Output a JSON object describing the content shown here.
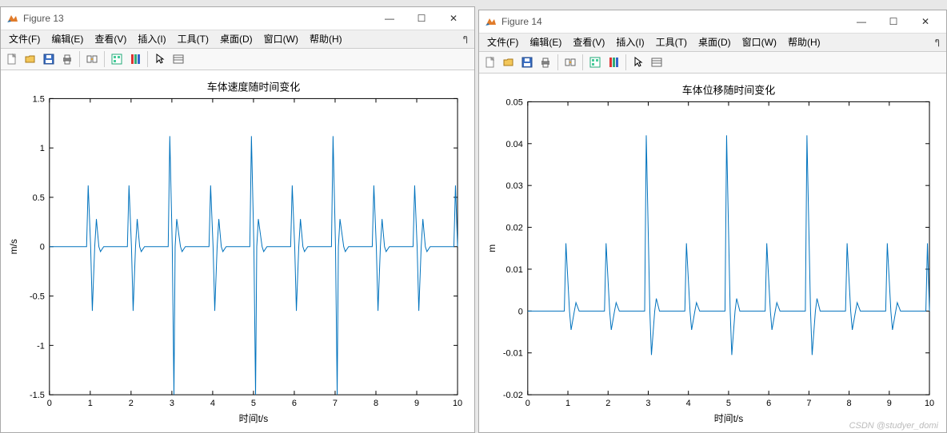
{
  "watermark": "CSDN @studyer_domi",
  "figures": [
    {
      "id": "fig13",
      "window_title": "Figure 13",
      "menus": [
        "文件(F)",
        "编辑(E)",
        "查看(V)",
        "插入(I)",
        "工具(T)",
        "桌面(D)",
        "窗口(W)",
        "帮助(H)"
      ],
      "title": "车体速度随时间变化",
      "xlabel": "时间t/s",
      "ylabel": "m/s",
      "xlim": [
        0,
        10
      ],
      "ylim": [
        -1.5,
        1.5
      ],
      "xticks": [
        0,
        1,
        2,
        3,
        4,
        5,
        6,
        7,
        8,
        9,
        10
      ],
      "yticks": [
        -1.5,
        -1,
        -0.5,
        0,
        0.5,
        1,
        1.5
      ]
    },
    {
      "id": "fig14",
      "window_title": "Figure 14",
      "menus": [
        "文件(F)",
        "编辑(E)",
        "查看(V)",
        "插入(I)",
        "工具(T)",
        "桌面(D)",
        "窗口(W)",
        "帮助(H)"
      ],
      "title": "车体位移随时间变化",
      "xlabel": "时间t/s",
      "ylabel": "m",
      "xlim": [
        0,
        10
      ],
      "ylim": [
        -0.02,
        0.05
      ],
      "xticks": [
        0,
        1,
        2,
        3,
        4,
        5,
        6,
        7,
        8,
        9,
        10
      ],
      "yticks": [
        -0.02,
        -0.01,
        0,
        0.01,
        0.02,
        0.03,
        0.04,
        0.05
      ]
    }
  ],
  "toolbar_icons": [
    "new-icon",
    "open-icon",
    "save-icon",
    "print-icon",
    "sep",
    "link-icon",
    "sep",
    "datacursor-icon",
    "colorbar-icon",
    "sep",
    "pointer-icon",
    "props-icon"
  ],
  "chart_data": [
    {
      "type": "line",
      "figure": "fig13",
      "title": "车体速度随时间变化",
      "xlabel": "时间t/s",
      "ylabel": "m/s",
      "xlim": [
        0,
        10
      ],
      "ylim": [
        -1.5,
        1.5
      ],
      "series": [
        {
          "name": "velocity",
          "color": "#0072bd",
          "pattern": "periodic_pulses",
          "period": 1.0,
          "baseline": 0.0,
          "peaks": [
            {
              "t": 0.95,
              "y": 0.62
            },
            {
              "t": 1.05,
              "y": -0.65
            },
            {
              "t": 1.15,
              "y": 0.28
            },
            {
              "t": 1.25,
              "y": -0.05
            },
            {
              "t": 1.95,
              "y": 0.62
            },
            {
              "t": 2.05,
              "y": -0.65
            },
            {
              "t": 2.15,
              "y": 0.28
            },
            {
              "t": 2.25,
              "y": -0.05
            },
            {
              "t": 2.95,
              "y": 1.12
            },
            {
              "t": 3.05,
              "y": -1.6
            },
            {
              "t": 3.12,
              "y": 0.28
            },
            {
              "t": 3.25,
              "y": -0.05
            },
            {
              "t": 3.95,
              "y": 0.62
            },
            {
              "t": 4.05,
              "y": -0.65
            },
            {
              "t": 4.15,
              "y": 0.28
            },
            {
              "t": 4.25,
              "y": -0.05
            },
            {
              "t": 4.95,
              "y": 1.12
            },
            {
              "t": 5.05,
              "y": -1.6
            },
            {
              "t": 5.12,
              "y": 0.28
            },
            {
              "t": 5.25,
              "y": -0.05
            },
            {
              "t": 5.95,
              "y": 0.62
            },
            {
              "t": 6.05,
              "y": -0.65
            },
            {
              "t": 6.15,
              "y": 0.28
            },
            {
              "t": 6.25,
              "y": -0.05
            },
            {
              "t": 6.95,
              "y": 1.12
            },
            {
              "t": 7.05,
              "y": -1.6
            },
            {
              "t": 7.12,
              "y": 0.28
            },
            {
              "t": 7.25,
              "y": -0.05
            },
            {
              "t": 7.95,
              "y": 0.62
            },
            {
              "t": 8.05,
              "y": -0.65
            },
            {
              "t": 8.15,
              "y": 0.28
            },
            {
              "t": 8.25,
              "y": -0.05
            },
            {
              "t": 8.95,
              "y": 0.62
            },
            {
              "t": 9.05,
              "y": -0.65
            },
            {
              "t": 9.15,
              "y": 0.28
            },
            {
              "t": 9.25,
              "y": -0.05
            },
            {
              "t": 9.95,
              "y": 0.62
            }
          ]
        }
      ]
    },
    {
      "type": "line",
      "figure": "fig14",
      "title": "车体位移随时间变化",
      "xlabel": "时间t/s",
      "ylabel": "m",
      "xlim": [
        0,
        10
      ],
      "ylim": [
        -0.02,
        0.05
      ],
      "series": [
        {
          "name": "displacement",
          "color": "#0072bd",
          "pattern": "periodic_pulses",
          "period": 1.0,
          "baseline": 0.0,
          "peaks": [
            {
              "t": 0.95,
              "y": 0.0162
            },
            {
              "t": 1.08,
              "y": -0.0045
            },
            {
              "t": 1.2,
              "y": 0.002
            },
            {
              "t": 1.95,
              "y": 0.0162
            },
            {
              "t": 2.08,
              "y": -0.0045
            },
            {
              "t": 2.2,
              "y": 0.002
            },
            {
              "t": 2.95,
              "y": 0.042
            },
            {
              "t": 3.08,
              "y": -0.0105
            },
            {
              "t": 3.2,
              "y": 0.003
            },
            {
              "t": 3.95,
              "y": 0.0162
            },
            {
              "t": 4.08,
              "y": -0.0045
            },
            {
              "t": 4.2,
              "y": 0.002
            },
            {
              "t": 4.95,
              "y": 0.042
            },
            {
              "t": 5.08,
              "y": -0.0105
            },
            {
              "t": 5.2,
              "y": 0.003
            },
            {
              "t": 5.95,
              "y": 0.0162
            },
            {
              "t": 6.08,
              "y": -0.0045
            },
            {
              "t": 6.2,
              "y": 0.002
            },
            {
              "t": 6.95,
              "y": 0.042
            },
            {
              "t": 7.08,
              "y": -0.0105
            },
            {
              "t": 7.2,
              "y": 0.003
            },
            {
              "t": 7.95,
              "y": 0.0162
            },
            {
              "t": 8.08,
              "y": -0.0045
            },
            {
              "t": 8.2,
              "y": 0.002
            },
            {
              "t": 8.95,
              "y": 0.0162
            },
            {
              "t": 9.08,
              "y": -0.0045
            },
            {
              "t": 9.2,
              "y": 0.002
            },
            {
              "t": 9.95,
              "y": 0.0162
            }
          ]
        }
      ]
    }
  ]
}
